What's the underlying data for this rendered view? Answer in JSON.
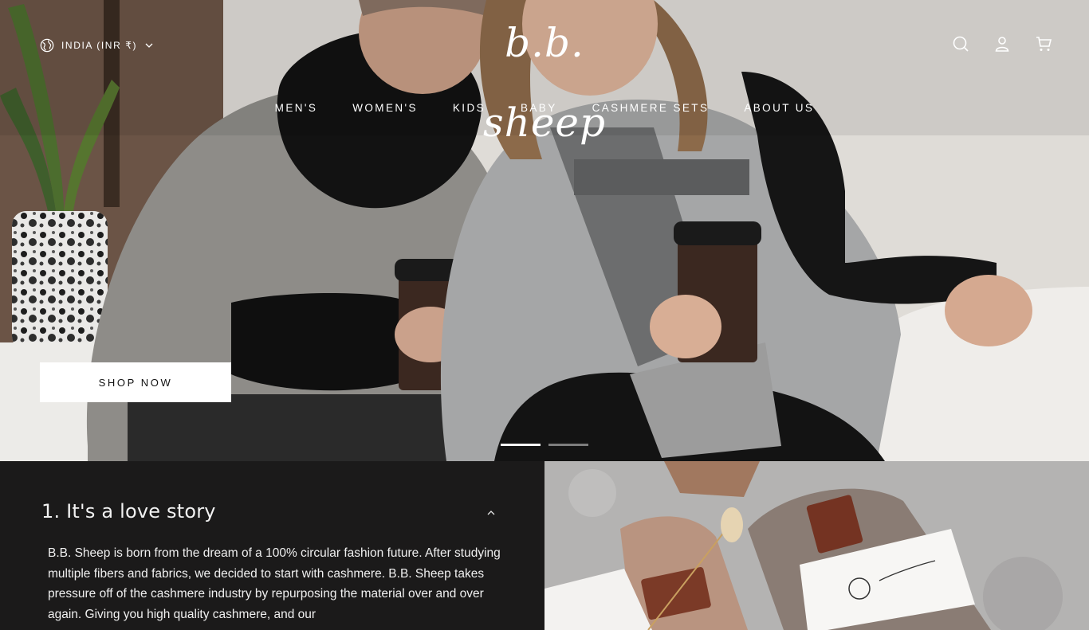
{
  "header": {
    "country_selector": "INDIA (INR ₹)",
    "logo": "b.b. sheep",
    "icons": [
      "search-icon",
      "account-icon",
      "cart-icon"
    ]
  },
  "nav": {
    "items": [
      "MEN'S",
      "WOMEN'S",
      "KIDS",
      "BABY",
      "CASHMERE SETS",
      "ABOUT US"
    ]
  },
  "hero": {
    "cta_label": "SHOP NOW",
    "slides_total": 2,
    "active_slide": 1
  },
  "story": {
    "heading": "1. It's a love story",
    "body": "B.B. Sheep is born from the dream of a 100% circular fashion future. After studying multiple fibers and fabrics, we decided to start with cashmere. B.B. Sheep takes pressure off of the cashmere industry by repurposing the material over and over again. Giving you high quality cashmere, and our"
  },
  "colors": {
    "accent": "#ffffff",
    "story_bg": "#1b1a1a",
    "button_text": "#111111"
  }
}
